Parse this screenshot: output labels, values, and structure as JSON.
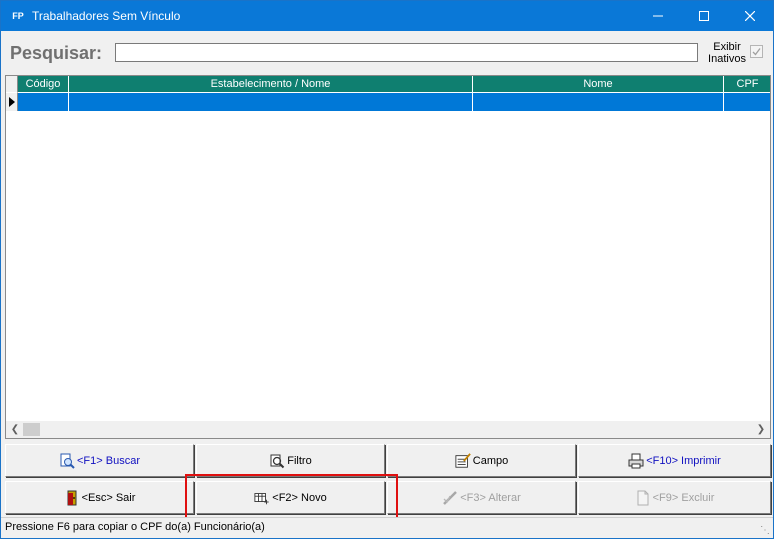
{
  "window": {
    "app_icon_text": "FP",
    "title": "Trabalhadores Sem Vínculo",
    "controls": {
      "minimize": "minimize-icon",
      "maximize": "maximize-icon",
      "close": "close-icon"
    }
  },
  "search": {
    "label": "Pesquisar:",
    "value": "",
    "placeholder": "",
    "show_inactive_label": "Exibir Inativos",
    "show_inactive_checked": true
  },
  "grid": {
    "columns": [
      "Código",
      "Estabelecimento / Nome",
      "Nome",
      "CPF"
    ],
    "rows": [
      {
        "codigo": "",
        "estabelecimento": "",
        "nome": "",
        "cpf": "",
        "selected": true
      }
    ],
    "colors": {
      "header_bg": "#0f7f70",
      "selected_row_bg": "#0078d7"
    }
  },
  "buttons": {
    "row1": [
      {
        "label": "<F1> Buscar",
        "icon": "search-doc-icon",
        "state": "enabled",
        "tone": "blue"
      },
      {
        "label": "Filtro",
        "icon": "filter-icon",
        "state": "enabled",
        "tone": "dark"
      },
      {
        "label": "Campo",
        "icon": "field-icon",
        "state": "enabled",
        "tone": "dark"
      },
      {
        "label": "<F10> Imprimir",
        "icon": "printer-icon",
        "state": "enabled",
        "tone": "blue"
      }
    ],
    "row2": [
      {
        "label": "<Esc> Sair",
        "icon": "exit-door-icon",
        "state": "enabled",
        "tone": "dark"
      },
      {
        "label": "<F2> Novo",
        "icon": "new-record-icon",
        "state": "enabled",
        "tone": "dark",
        "highlighted": true
      },
      {
        "label": "<F3> Alterar",
        "icon": "edit-icon",
        "state": "disabled",
        "tone": "dark"
      },
      {
        "label": "<F9> Excluir",
        "icon": "delete-icon",
        "state": "disabled",
        "tone": "dark"
      }
    ]
  },
  "status": {
    "text": "Pressione F6 para copiar o CPF do(a) Funcionário(a)"
  }
}
